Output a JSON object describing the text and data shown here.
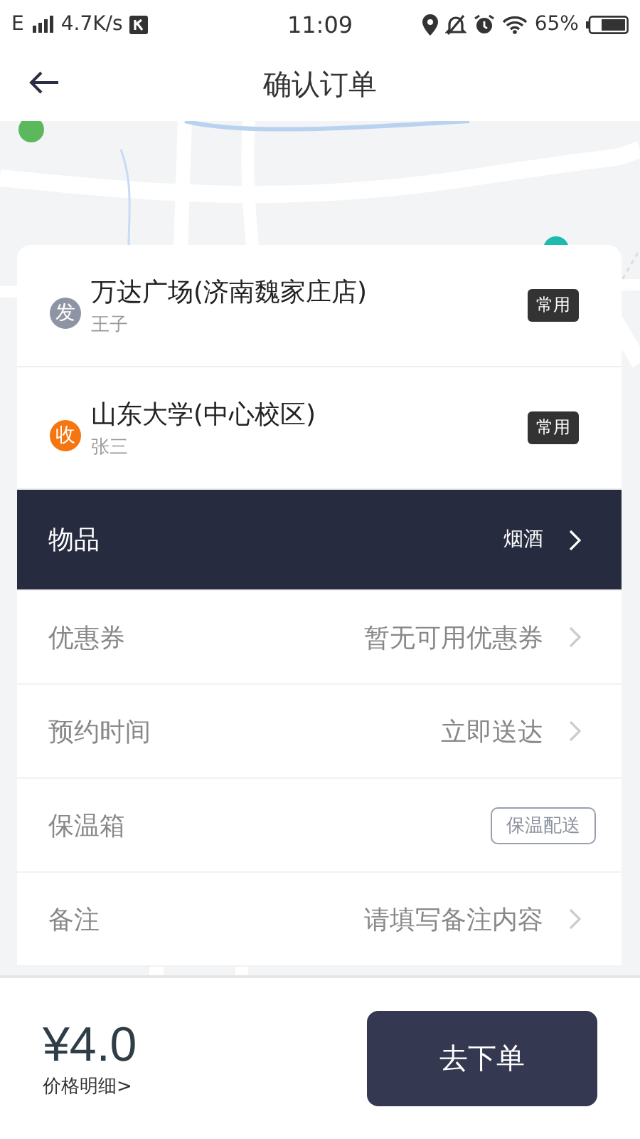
{
  "status_bar": {
    "network": "E",
    "speed": "4.7K/s",
    "time": "11:09",
    "battery": "65%"
  },
  "header": {
    "title": "确认订单"
  },
  "addresses": [
    {
      "badge": "发",
      "color": "#8e94a3",
      "name": "万达广场(济南魏家庄店)",
      "contact": "王子",
      "tag": "常用"
    },
    {
      "badge": "收",
      "color": "#f5750f",
      "name": "山东大学(中心校区)",
      "contact": "张三",
      "tag": "常用"
    }
  ],
  "options": [
    {
      "kind": "link",
      "label": "物品",
      "value": "烟酒",
      "selected": true
    },
    {
      "kind": "link",
      "label": "优惠券",
      "value": "暂无可用优惠券",
      "selected": false
    },
    {
      "kind": "link",
      "label": "预约时间",
      "value": "立即送达",
      "selected": false
    },
    {
      "kind": "tag",
      "label": "保温箱",
      "value": "保温配送",
      "selected": false
    },
    {
      "kind": "link",
      "label": "备注",
      "value": "请填写备注内容",
      "selected": false
    }
  ],
  "footer": {
    "price": "¥4.0",
    "detail": "价格明细>",
    "submit": "去下单"
  }
}
